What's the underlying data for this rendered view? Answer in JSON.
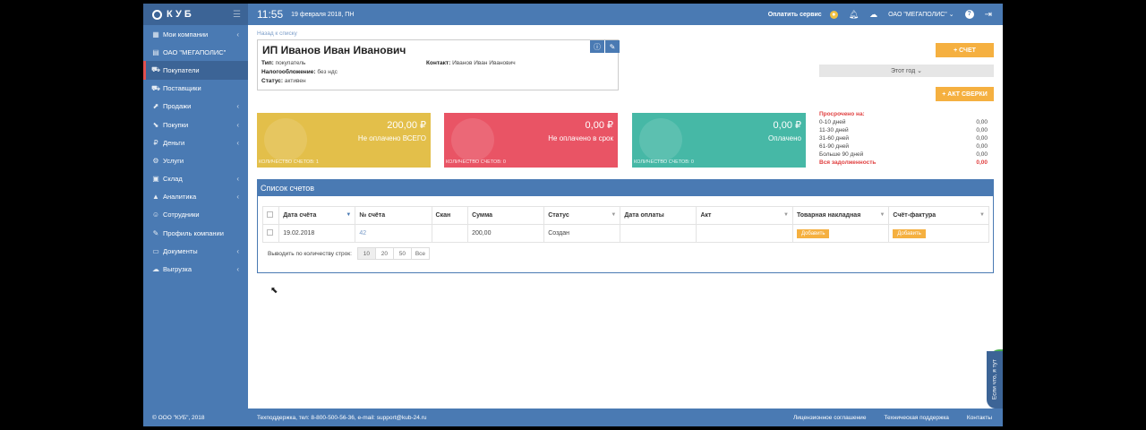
{
  "app": {
    "logo": "КУБ",
    "copyright": "© ООО \"КУБ\", 2018"
  },
  "topbar": {
    "time": "11:55",
    "date": "19 февраля 2018, ПН",
    "pay_service": "Оплатить сервис",
    "company": "ОАО \"МЕГАПОЛИС\""
  },
  "sidebar": {
    "items": [
      {
        "label": "Мои компании",
        "icon": "building-icon",
        "glyph": "▦",
        "chevron": true
      },
      {
        "label": "ОАО \"МЕГАПОЛИС\"",
        "icon": "company-icon",
        "glyph": "▤",
        "chevron": false
      },
      {
        "label": "Покупатели",
        "icon": "cart-icon",
        "glyph": "⛟",
        "chevron": false,
        "active": true
      },
      {
        "label": "Поставщики",
        "icon": "truck-icon",
        "glyph": "⛟",
        "chevron": false
      },
      {
        "label": "Продажи",
        "icon": "sales-icon",
        "glyph": "⬈",
        "chevron": true
      },
      {
        "label": "Покупки",
        "icon": "purchase-icon",
        "glyph": "⬊",
        "chevron": true
      },
      {
        "label": "Деньги",
        "icon": "money-icon",
        "glyph": "₽",
        "chevron": true
      },
      {
        "label": "Услуги",
        "icon": "services-icon",
        "glyph": "⚙",
        "chevron": false
      },
      {
        "label": "Склад",
        "icon": "warehouse-icon",
        "glyph": "▣",
        "chevron": true
      },
      {
        "label": "Аналитика",
        "icon": "analytics-icon",
        "glyph": "▲",
        "chevron": true
      },
      {
        "label": "Сотрудники",
        "icon": "employees-icon",
        "glyph": "☺",
        "chevron": false
      },
      {
        "label": "Профиль компании",
        "icon": "profile-icon",
        "glyph": "✎",
        "chevron": false
      },
      {
        "label": "Документы",
        "icon": "documents-icon",
        "glyph": "▭",
        "chevron": true
      },
      {
        "label": "Выгрузка",
        "icon": "export-icon",
        "glyph": "☁",
        "chevron": true
      }
    ]
  },
  "content": {
    "back": "Назад к списку",
    "title": "ИП Иванов Иван Иванович",
    "type_label": "Тип:",
    "type_value": "покупатель",
    "tax_label": "Налогообложение:",
    "tax_value": "без ндс",
    "status_label": "Статус:",
    "status_value": "активен",
    "contact_label": "Контакт:",
    "contact_value": "Иванов Иван Иванович",
    "btn_invoice": "+ СЧЕТ",
    "period": "Этот год ⌄",
    "btn_act": "+ АКТ СВЕРКИ"
  },
  "kpis": [
    {
      "amount": "200,00 ₽",
      "label": "Не оплачено ВСЕГО",
      "count": "КОЛИЧЕСТВО СЧЕТОВ: 1",
      "color": "#e3bf4a"
    },
    {
      "amount": "0,00 ₽",
      "label": "Не оплачено в срок",
      "count": "КОЛИЧЕСТВО СЧЕТОВ: 0",
      "color": "#e95465"
    },
    {
      "amount": "0,00 ₽",
      "label": "Оплачено",
      "count": "КОЛИЧЕСТВО СЧЕТОВ: 0",
      "color": "#46b8a6"
    }
  ],
  "overdue": {
    "title": "Просрочено на:",
    "rows": [
      {
        "label": "0-10 дней",
        "value": "0,00"
      },
      {
        "label": "11-30 дней",
        "value": "0,00"
      },
      {
        "label": "31-60 дней",
        "value": "0,00"
      },
      {
        "label": "61-90 дней",
        "value": "0,00"
      },
      {
        "label": "Больше 90 дней",
        "value": "0,00"
      },
      {
        "label": "Вся задолженность",
        "value": "0,00"
      }
    ]
  },
  "invoices": {
    "title": "Список счетов",
    "columns": [
      "Дата счёта",
      "№ счёта",
      "Скан",
      "Сумма",
      "Статус",
      "Дата оплаты",
      "Акт",
      "Товарная накладная",
      "Счёт-фактура"
    ],
    "rows": [
      {
        "date": "19.02.2018",
        "number": "42",
        "scan": "",
        "sum": "200,00",
        "status": "Создан",
        "paid": "",
        "act": "",
        "waybill": "Добавить",
        "facture": "Добавить"
      }
    ],
    "pager_label": "Выводить по количеству строк:",
    "pager_options": [
      "10",
      "20",
      "50",
      "Все"
    ]
  },
  "footer": {
    "support": "Техподдержка, тел: 8-800-500-56-36, e-mail: support@kub-24.ru",
    "license": "Лицензионное соглашение",
    "tech": "Техническая поддержка",
    "contacts": "Контакты"
  },
  "side_tab": "Если что, я тут"
}
